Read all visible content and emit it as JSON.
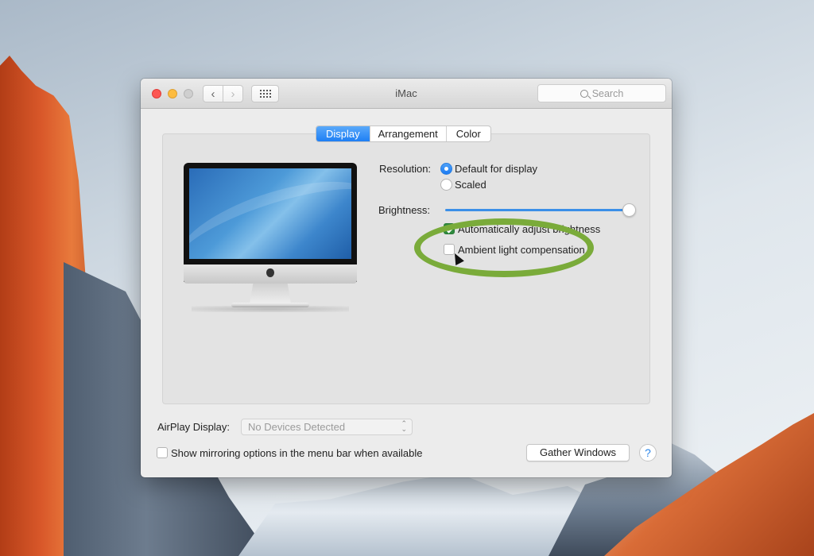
{
  "window": {
    "title": "iMac",
    "search_placeholder": "Search",
    "nav": {
      "back_glyph": "‹",
      "forward_glyph": "›"
    }
  },
  "tabs": [
    {
      "label": "Display",
      "active": true
    },
    {
      "label": "Arrangement",
      "active": false
    },
    {
      "label": "Color",
      "active": false
    }
  ],
  "display": {
    "resolution_label": "Resolution:",
    "resolution_options": [
      {
        "label": "Default for display",
        "selected": true
      },
      {
        "label": "Scaled",
        "selected": false
      }
    ],
    "brightness_label": "Brightness:",
    "brightness_value": 1.0,
    "auto_brightness": {
      "label": "Automatically adjust brightness",
      "checked": true
    },
    "ambient_light": {
      "label": "Ambient light compensation",
      "checked": false
    }
  },
  "airplay": {
    "label": "AirPlay Display:",
    "selected": "No Devices Detected",
    "arrows": "⌃⌄"
  },
  "mirroring": {
    "label": "Show mirroring options in the menu bar when available",
    "checked": false
  },
  "buttons": {
    "gather_windows": "Gather Windows",
    "help": "?"
  },
  "annotation": {
    "highlight_color": "#7aab3a"
  },
  "colors": {
    "accent": "#1e7ff4",
    "checkbox_checked": "#2e8a3e"
  }
}
